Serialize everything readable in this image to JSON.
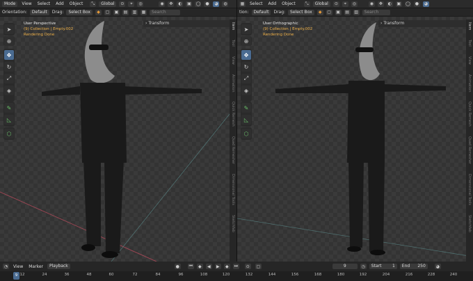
{
  "left": {
    "header": {
      "mode": "Mode",
      "menus": [
        "View",
        "Select",
        "Add",
        "Object"
      ],
      "transform": "Global"
    },
    "subheader": {
      "orientation_label": "Orientation:",
      "orientation": "Default",
      "drag_label": "Drag:",
      "drag": "Select Box",
      "search_placeholder": "Search"
    },
    "view_info": {
      "title": "User Perspective",
      "collection": "(9) Collection | Empty.002",
      "status": "Rendering Done"
    },
    "transform_panel": "Transform",
    "npanel_tabs": [
      "Item",
      "Tool",
      "View",
      "Animation",
      "Quick Remesh",
      "Quad Remesher",
      "Dimensional Tools",
      "Sketchfab"
    ]
  },
  "right": {
    "header": {
      "menus": [
        "Select",
        "Add",
        "Object"
      ],
      "transform": "Global"
    },
    "subheader": {
      "orientation_label": "tion:",
      "orientation": "Default",
      "drag_label": "Drag:",
      "drag": "Select Box",
      "search_placeholder": "Search"
    },
    "view_info": {
      "title": "User Orthographic",
      "collection": "(9) Collection | Empty.002",
      "status": "Rendering Done"
    },
    "transform_panel": "Transform",
    "npanel_tabs": [
      "Item",
      "Tool",
      "View",
      "Animation",
      "Quick Remesh",
      "Quad Remesher",
      "Dimensional Tools",
      "Sketchfab"
    ]
  },
  "tools": [
    "cursor-icon",
    "cursor-3d-icon",
    "move-icon",
    "rotate-icon",
    "scale-icon",
    "transform-icon",
    "annotate-icon",
    "measure-icon",
    "add-cube-icon"
  ],
  "timeline": {
    "menus": [
      "View",
      "Marker"
    ],
    "playback": "Playback",
    "current_frame": "9",
    "start_label": "Start",
    "start": "1",
    "end_label": "End",
    "end": "250",
    "frame_indicator": "9",
    "ticks": [
      "12",
      "24",
      "36",
      "48",
      "60",
      "72",
      "84",
      "96",
      "108",
      "120",
      "132",
      "144",
      "156",
      "168",
      "180",
      "192",
      "204",
      "216",
      "228",
      "240"
    ]
  },
  "colors": {
    "accent": "#4a6b91",
    "status_orange": "#f0b24a",
    "axis_x": "#b24a5a",
    "axis_y": "#5a8a4a"
  }
}
